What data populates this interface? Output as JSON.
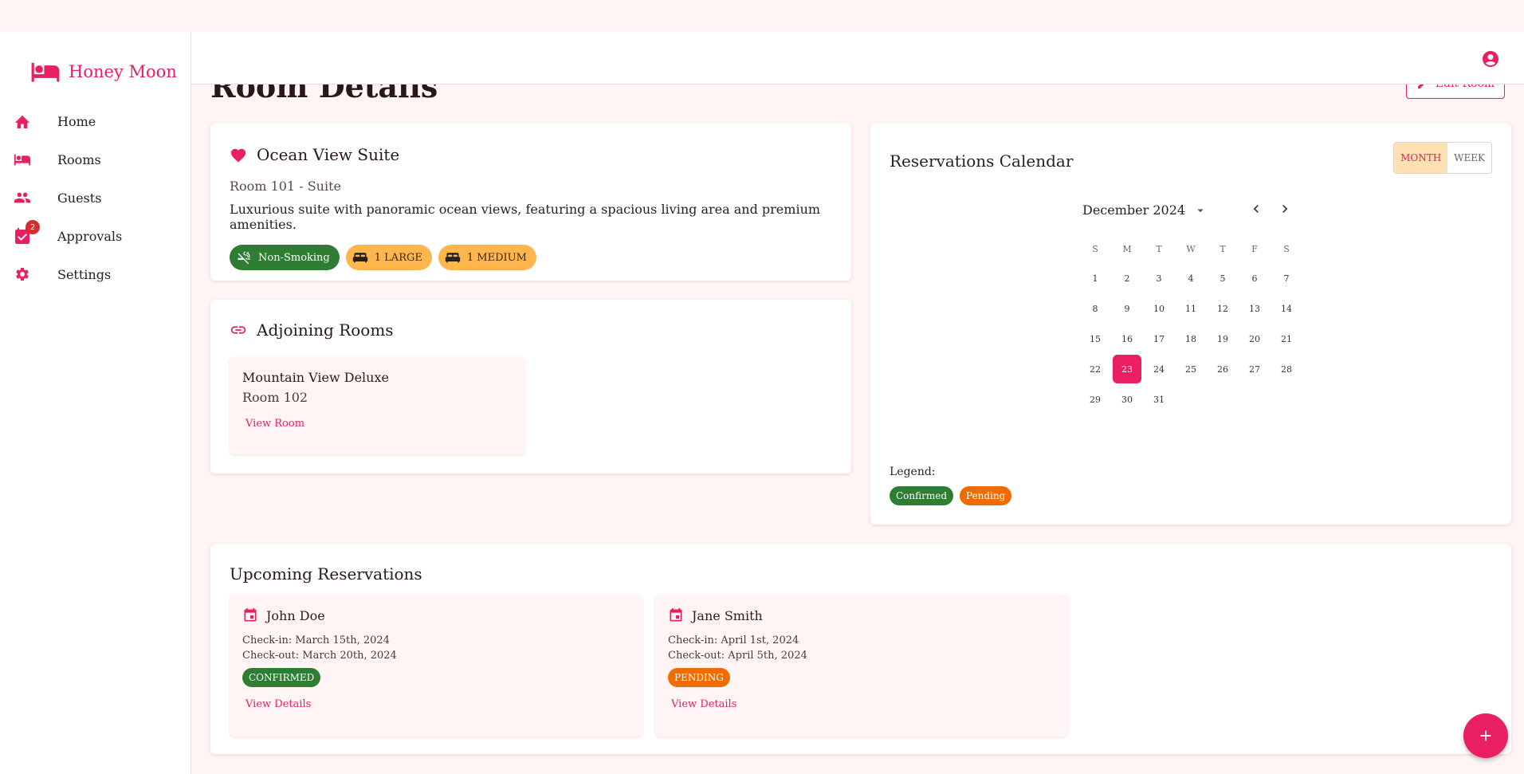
{
  "app": {
    "brand": "Honey Moon"
  },
  "colors": {
    "accent": "#e91e63",
    "confirmed": "#2e7d32",
    "pending": "#ef6c00",
    "bed_chip": "#ffb74d"
  },
  "sidebar": {
    "items": [
      {
        "label": "Home",
        "icon": "home-icon"
      },
      {
        "label": "Rooms",
        "icon": "bed-icon"
      },
      {
        "label": "Guests",
        "icon": "people-icon"
      },
      {
        "label": "Approvals",
        "icon": "approval-icon",
        "badge": "2"
      },
      {
        "label": "Settings",
        "icon": "gear-icon"
      }
    ]
  },
  "page": {
    "title": "Room Details",
    "edit_label": "Edit Room"
  },
  "room": {
    "name": "Ocean View Suite",
    "subtitle": "Room 101 - Suite",
    "description": "Luxurious suite with panoramic ocean views, featuring a spacious living area and premium amenities.",
    "chips": [
      "Non-Smoking",
      "1 LARGE",
      "1 MEDIUM"
    ]
  },
  "adjoining": {
    "title": "Adjoining Rooms",
    "rooms": [
      {
        "name": "Mountain View Deluxe",
        "number": "Room 102",
        "link": "View Room"
      }
    ]
  },
  "calendar": {
    "title": "Reservations Calendar",
    "views": [
      "MONTH",
      "WEEK"
    ],
    "active_view": "MONTH",
    "month_label": "December 2024",
    "weekdays": [
      "S",
      "M",
      "T",
      "W",
      "T",
      "F",
      "S"
    ],
    "days": [
      "1",
      "2",
      "3",
      "4",
      "5",
      "6",
      "7",
      "8",
      "9",
      "10",
      "11",
      "12",
      "13",
      "14",
      "15",
      "16",
      "17",
      "18",
      "19",
      "20",
      "21",
      "22",
      "23",
      "24",
      "25",
      "26",
      "27",
      "28",
      "29",
      "30",
      "31"
    ],
    "selected_day": "23",
    "legend_label": "Legend:",
    "legend": [
      "Confirmed",
      "Pending"
    ]
  },
  "reservations": {
    "title": "Upcoming Reservations",
    "items": [
      {
        "guest": "John Doe",
        "checkin": "Check-in: March 15th, 2024",
        "checkout": "Check-out: March 20th, 2024",
        "status": "CONFIRMED",
        "link": "View Details"
      },
      {
        "guest": "Jane Smith",
        "checkin": "Check-in: April 1st, 2024",
        "checkout": "Check-out: April 5th, 2024",
        "status": "PENDING",
        "link": "View Details"
      }
    ]
  }
}
